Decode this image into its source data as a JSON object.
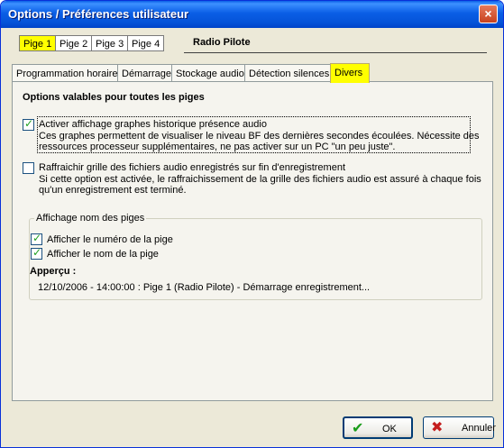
{
  "window": {
    "title": "Options / Préférences utilisateur",
    "close_symbol": "×"
  },
  "piges": {
    "tabs": [
      {
        "label": "Pige 1",
        "active": true
      },
      {
        "label": "Pige 2",
        "active": false
      },
      {
        "label": "Pige 3",
        "active": false
      },
      {
        "label": "Pige 4",
        "active": false
      }
    ],
    "selected_name": "Radio Pilote"
  },
  "tabs": [
    {
      "label": "Programmation horaire",
      "active": false
    },
    {
      "label": "Démarrage",
      "active": false
    },
    {
      "label": "Stockage audio",
      "active": false
    },
    {
      "label": "Détection silences",
      "active": false
    },
    {
      "label": "Divers",
      "active": true
    }
  ],
  "divers": {
    "section_title": "Options valables pour toutes les piges",
    "options": [
      {
        "checked": true,
        "label": "Activer affichage graphes historique présence audio",
        "desc_line1": "Ces graphes permettent de visualiser le niveau BF des dernières secondes écoulées. Nécessite des",
        "desc_line2": "ressources processeur supplémentaires, ne pas activer sur un PC \"un peu juste\"."
      },
      {
        "checked": false,
        "label": "Raffraichir grille des fichiers audio enregistrés sur fin d'enregistrement",
        "desc_line1": "Si cette option est activée, le raffraichissement de la grille des fichiers audio est assuré à chaque fois",
        "desc_line2": "qu'un enregistrement est terminé."
      }
    ],
    "group": {
      "title": "Affichage nom des piges",
      "checks": [
        {
          "checked": true,
          "label": "Afficher le numéro de la pige"
        },
        {
          "checked": true,
          "label": "Afficher le nom de la pige"
        }
      ],
      "preview_label": "Apperçu :",
      "preview_value": "12/10/2006 - 14:00:00 : Pige 1 (Radio Pilote) - Démarrage enregistrement..."
    }
  },
  "buttons": {
    "ok": {
      "label": "OK",
      "icon": "checkmark-icon",
      "color": "#1a9c1a"
    },
    "cancel": {
      "label": "Annuler",
      "icon": "cross-icon",
      "color": "#c41e1e"
    }
  },
  "colors": {
    "accent_tab": "#ffff00",
    "titlebar": "#0a5fe6"
  }
}
